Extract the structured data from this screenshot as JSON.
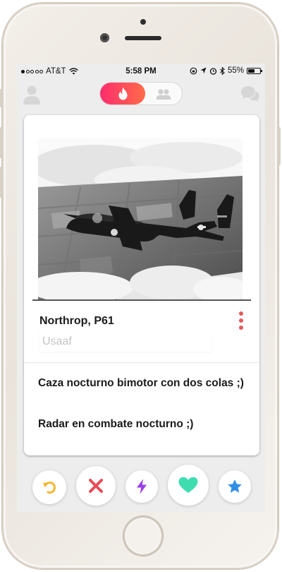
{
  "status_bar": {
    "carrier": "AT&T",
    "time": "5:58 PM",
    "battery": "55%",
    "battery_level": 0.55
  },
  "nav": {
    "profile_icon": "person-icon",
    "mode_active_icon": "flame-icon",
    "mode_inactive_icon": "group-icon",
    "chat_icon": "chat-bubbles-icon"
  },
  "card": {
    "photo": "black-and-white photo of a twin-boom night fighter aircraft in flight above clouds and farmland",
    "name": "Northrop, P61",
    "subtitle": "Usaaf",
    "description_1": "Caza nocturno bimotor con dos colas ;)",
    "description_2": "Radar en combate nocturno ;)",
    "accent_color": "#e35a5a"
  },
  "actions": [
    {
      "icon": "rewind-icon",
      "color": "#f5b731"
    },
    {
      "icon": "close-x-icon",
      "color": "#e94b55"
    },
    {
      "icon": "lightning-icon",
      "color": "#9b3ee6"
    },
    {
      "icon": "heart-icon",
      "color": "#3fdcb0"
    },
    {
      "icon": "star-icon",
      "color": "#2f8fe6"
    }
  ],
  "colors": {
    "brand_gradient_start": "#fd2d6d",
    "brand_gradient_end": "#ff6b49"
  }
}
